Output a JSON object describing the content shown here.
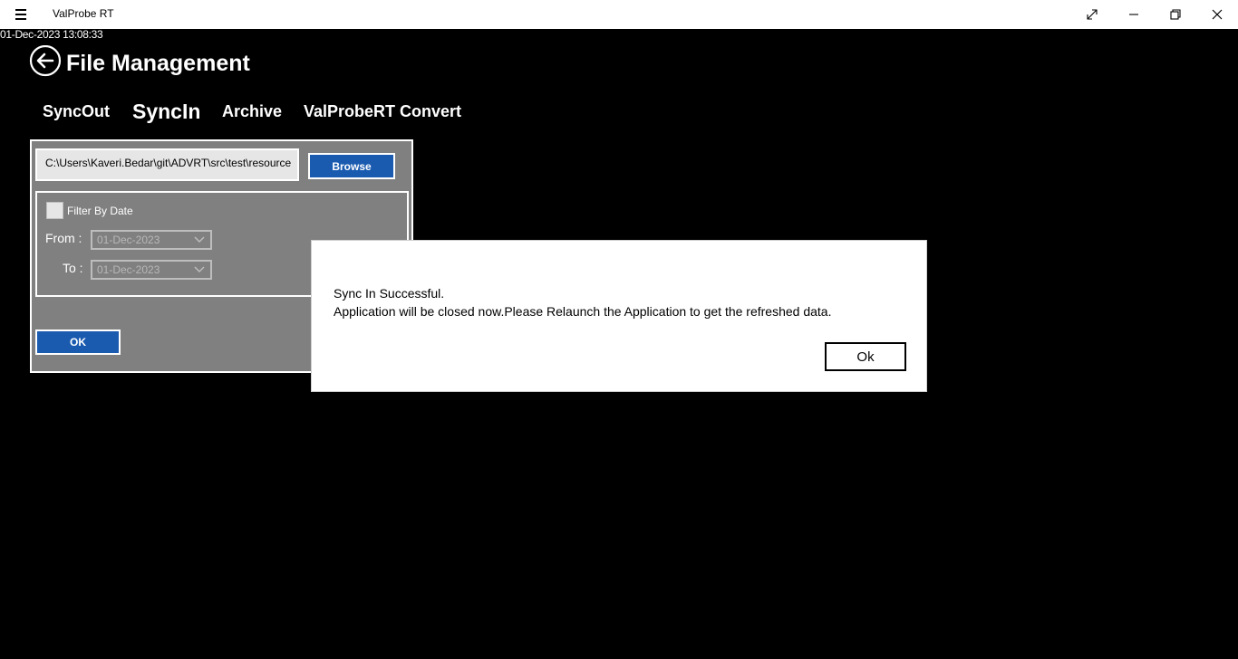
{
  "window": {
    "title": "ValProbe RT",
    "icons": {
      "menu": "hamburger-icon",
      "fullscreen": "fullscreen-icon",
      "minimize": "minimize-icon",
      "restore": "restore-icon",
      "close": "close-icon"
    }
  },
  "datetime": "01-Dec-2023 13:08:33",
  "page": {
    "title": "File Management",
    "back_icon": "back-arrow-icon"
  },
  "tabs": [
    {
      "label": "SyncOut",
      "active": false
    },
    {
      "label": "SyncIn",
      "active": true
    },
    {
      "label": "Archive",
      "active": false
    },
    {
      "label": "ValProbeRT Convert",
      "active": false
    }
  ],
  "syncin": {
    "path_value": "C:\\Users\\Kaveri.Bedar\\git\\ADVRT\\src\\test\\resource",
    "browse_label": "Browse",
    "filter_label": "Filter By Date",
    "filter_checked": false,
    "from_label": "From :",
    "from_value": "01-Dec-2023",
    "to_label": "To :",
    "to_value": "01-Dec-2023",
    "ok_label": "OK"
  },
  "dialog": {
    "line1": "Sync In Successful.",
    "line2": "Application will be closed now.Please Relaunch the Application to get the refreshed data.",
    "ok_label": "Ok"
  },
  "colors": {
    "background": "#000000",
    "panel": "#808080",
    "button_blue": "#1a5bb0",
    "dialog_bg": "#ffffff"
  }
}
